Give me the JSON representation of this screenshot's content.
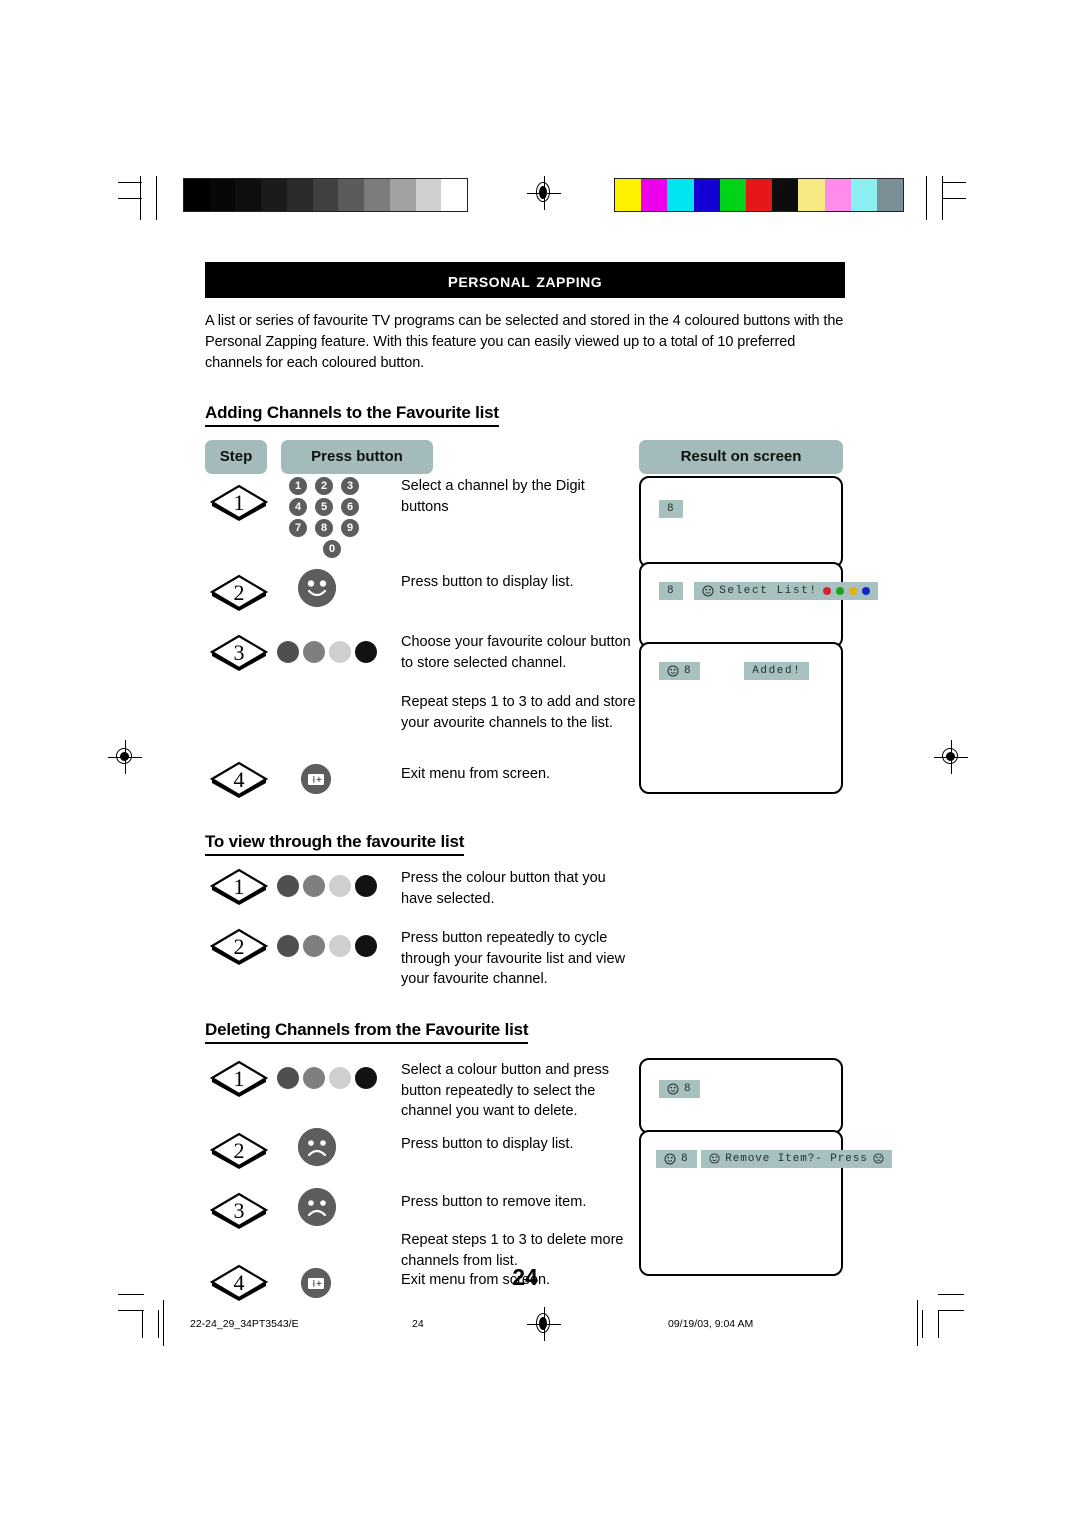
{
  "document": {
    "title": "Personal Zapping",
    "page_number": "24",
    "intro": "A list or series of favourite TV programs can be selected and stored in the 4 coloured buttons with the Personal Zapping feature. With this feature you can easily viewed up to a total of 10 preferred channels for each coloured button."
  },
  "table_headers": {
    "step": "Step",
    "press_button": "Press button",
    "result_on_screen": "Result on screen"
  },
  "sections": [
    {
      "heading": "Adding Channels to the Favourite list",
      "steps": [
        {
          "number": "1",
          "control": "digit-pad",
          "description": "Select a channel by the Digit buttons"
        },
        {
          "number": "2",
          "control": "smiley-button",
          "description": "Press button to display list."
        },
        {
          "number": "3",
          "control": "colour-dots",
          "description": "Choose your favourite colour button to store selected channel."
        },
        {
          "number": "",
          "control": "none",
          "description": "Repeat steps 1 to 3 to add and store your avourite channels to the list."
        },
        {
          "number": "4",
          "control": "menu-button",
          "description": "Exit menu from screen."
        }
      ]
    },
    {
      "heading": "To view through the favourite list",
      "steps": [
        {
          "number": "1",
          "control": "colour-dots",
          "description": "Press the colour button that you have selected."
        },
        {
          "number": "2",
          "control": "colour-dots",
          "description": "Press button repeatedly to cycle through your favourite list and view your favourite channel."
        }
      ]
    },
    {
      "heading": "Deleting Channels from the Favourite list",
      "steps": [
        {
          "number": "1",
          "control": "colour-dots",
          "description": "Select a colour button and press button repeatedly to select the channel you want to delete."
        },
        {
          "number": "2",
          "control": "sad-button",
          "description": "Press button to display list."
        },
        {
          "number": "3",
          "control": "sad-button",
          "description": "Press button to remove item."
        },
        {
          "number": "",
          "control": "none",
          "description": "Repeat steps 1 to 3 to delete more channels from list."
        },
        {
          "number": "4",
          "control": "menu-button",
          "description": "Exit menu from screen."
        }
      ]
    }
  ],
  "digit_pad": {
    "rows": [
      [
        "1",
        "2",
        "3"
      ],
      [
        "4",
        "5",
        "6"
      ],
      [
        "7",
        "8",
        "9"
      ]
    ],
    "zero": "0"
  },
  "colour_buttons": [
    "#4f4f4f",
    "#7f7f7f",
    "#cfcfcf",
    "#121212"
  ],
  "osd_screens_add": [
    {
      "name": "channel-number-screen",
      "chip_text": "8",
      "has_face": false
    },
    {
      "name": "select-list-screen",
      "chip_text": "8",
      "message": "Select List!",
      "has_face": true,
      "dots": [
        "#d6202a",
        "#17a513",
        "#e6b007",
        "#1227c9"
      ]
    },
    {
      "name": "added-screen",
      "chip_text": "8",
      "message": "Added!",
      "has_face": true
    }
  ],
  "osd_screens_delete": [
    {
      "name": "favourite-channel-screen",
      "chip_text": "8",
      "has_face": true
    },
    {
      "name": "remove-item-screen",
      "chip_text": "8",
      "message": "Remove Item?- Press",
      "has_face": true
    }
  ],
  "footer": {
    "file_id": "22-24_29_34PT3543/E",
    "page": "24",
    "timestamp": "09/19/03, 9:04 AM"
  },
  "calibration": {
    "grayscale_swatches": [
      "#000000",
      "#070707",
      "#0f0f0f",
      "#1b1b1b",
      "#2b2b2b",
      "#404040",
      "#5b5b5b",
      "#7c7c7c",
      "#a2a2a2",
      "#cfcfcf",
      "#ffffff"
    ],
    "colour_swatches": [
      "#fff200",
      "#ec00ec",
      "#00e5f0",
      "#1400d2",
      "#00d418",
      "#e61717",
      "#0d0d0d",
      "#f5eb82",
      "#ff8ceb",
      "#8cf0f0",
      "#7a8f96"
    ]
  },
  "colors": {
    "header_bg": "#000000",
    "pill_bg": "#a3bbbb",
    "osd_chip_bg": "#a7c0c0",
    "button_gray": "#5d5d5d"
  }
}
